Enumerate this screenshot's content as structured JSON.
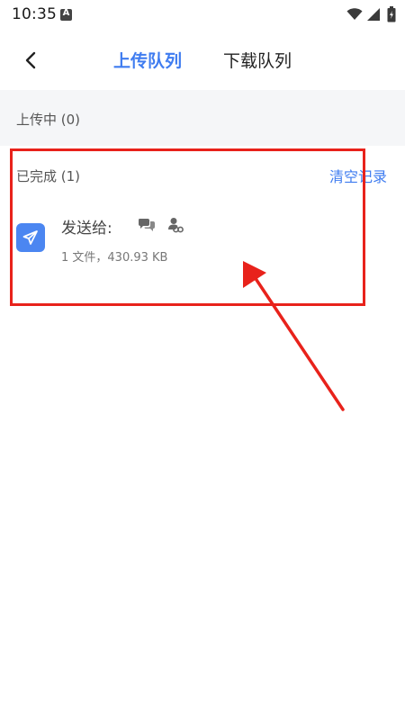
{
  "status_bar": {
    "time": "10:35",
    "notification_icon": "a-letter-icon",
    "indicators": [
      "wifi-icon",
      "signal-icon",
      "battery-icon"
    ]
  },
  "header": {
    "back_icon": "chevron-left-icon",
    "tabs": [
      {
        "label": "上传队列",
        "active": true
      },
      {
        "label": "下载队列",
        "active": false
      }
    ]
  },
  "uploading": {
    "label": "上传中 (0)"
  },
  "completed": {
    "label": "已完成 (1)",
    "clear_label": "清空记录",
    "items": [
      {
        "title": "发送给:",
        "recipient_icons": [
          "chat-bubbles-icon",
          "group-link-icon"
        ],
        "meta": "1 文件，430.93 KB",
        "icon": "send-icon"
      }
    ]
  },
  "colors": {
    "accent": "#3f7cf0",
    "annotation": "#e8221b",
    "section_bg": "#f5f6f8"
  }
}
